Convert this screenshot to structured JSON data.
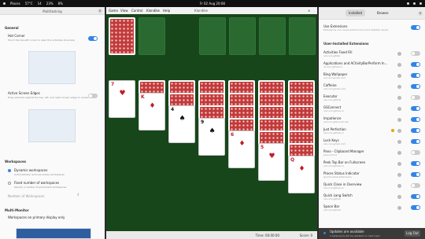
{
  "topbar": {
    "places": "Places",
    "clock": "Fr 02 Aug 20:08",
    "temp": "57°C",
    "load": "14",
    "cpu": "23%",
    "net": "8%"
  },
  "left": {
    "title": "Multitasking",
    "general": "General",
    "hot_corner": "Hot Corner",
    "hot_corner_desc": "Touch the top-left corner to open the Activities Overview",
    "active_edges": "Active Screen Edges",
    "active_edges_desc": "Drag windows against the top, left, and right screen edges to resize them",
    "workspaces": "Workspaces",
    "dynamic": "Dynamic workspaces",
    "dynamic_desc": "Automatically removes empty workspaces",
    "fixed": "Fixed number of workspaces",
    "fixed_desc": "Specify a number of permanent workspaces",
    "number_label": "Number of Workspaces",
    "number_value": "4",
    "multi_monitor": "Multi-Monitor",
    "primary_only": "Workspaces on primary display only"
  },
  "game": {
    "title": "Klondike",
    "menu": [
      "Game",
      "View",
      "Control",
      "Klondike",
      "Help"
    ],
    "time": "Time: 00:00:00",
    "score": "Score: 0",
    "cols": [
      {
        "rank": "7",
        "suit": "♥"
      },
      {
        "rank": "K",
        "suit": "♦"
      },
      {
        "rank": "4",
        "suit": "♠"
      },
      {
        "rank": "9",
        "suit": "♠"
      },
      {
        "rank": "6",
        "suit": "♦"
      },
      {
        "rank": "5",
        "suit": "♥"
      },
      {
        "rank": "Q",
        "suit": "♦"
      }
    ]
  },
  "right": {
    "tab_installed": "Installed",
    "tab_browse": "Browse",
    "use_ext": "Use Extensions",
    "use_ext_desc": "Extensions can cause performance and stability issues",
    "user_installed": "User-Installed Extensions",
    "exts": [
      {
        "n": "Activities Fixed Fill",
        "s": "xxx.xxx.gitlab",
        "on": false
      },
      {
        "n": "Applications and ACtivityBarPerform In...",
        "s": "xx.xxx.github.io",
        "on": true
      },
      {
        "n": "Bing Wallpaper",
        "s": "xxx.xxx.gmail.com",
        "on": true
      },
      {
        "n": "Caffeine",
        "s": "xxx.xxx.gmail.com",
        "on": true
      },
      {
        "n": "Executor",
        "s": "xxx.xxx.github",
        "on": false
      },
      {
        "n": "GSConnect",
        "s": "xxx.xxx.github.io",
        "on": true
      },
      {
        "n": "Impatience",
        "s": "xxx.xxx.gfxmonk.net",
        "on": true
      },
      {
        "n": "Just Perfection",
        "s": "xxx.xxx.github.io",
        "on": true,
        "warn": true
      },
      {
        "n": "Lock Keys",
        "s": "xxx.xxx.gmail.com",
        "on": true
      },
      {
        "n": "Pano - Clipboard Manager",
        "s": "pano.xxx.io",
        "on": false
      },
      {
        "n": "Peek Top Bar on Fullscreen",
        "s": "xxx.xxx.github.io",
        "on": true
      },
      {
        "n": "Places Status Indicator",
        "s": "gnome-shell-extensions",
        "on": true
      },
      {
        "n": "Quick Close in Overview",
        "s": "xxx.xxx.github.io",
        "on": false
      },
      {
        "n": "Quick Lang Switch",
        "s": "xxx.xxx.github",
        "on": true
      },
      {
        "n": "Space Bar",
        "s": "xxx.xxx.github",
        "on": true
      }
    ],
    "upd_title": "Updates are available",
    "upd_sub": "2 extensions will be updated on next login",
    "logout": "Log Out"
  }
}
